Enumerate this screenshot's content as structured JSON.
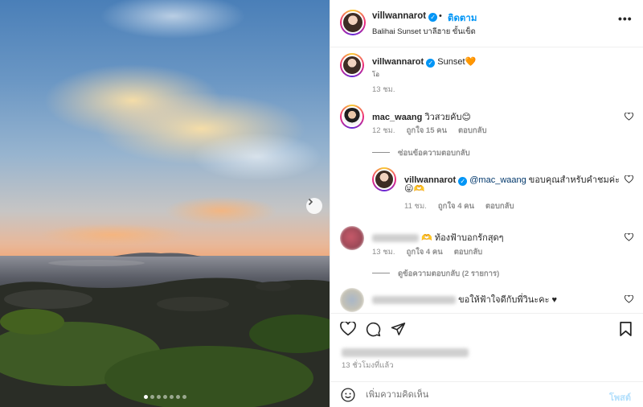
{
  "header": {
    "username": "villwannarot",
    "separator": "•",
    "follow_label": "ติดตาม",
    "location": "Balihai Sunset บาลีฮาย ขั้นเข็ด",
    "more_label": "•••"
  },
  "caption": {
    "username": "villwannarot",
    "text": "Sunset",
    "emoji": "🧡",
    "subtext": "โอ",
    "time": "13 ชม."
  },
  "comments": [
    {
      "username": "mac_waang",
      "text": "วิวสวยคับ😊",
      "time": "12 ชม.",
      "likes": "ถูกใจ 15 คน",
      "reply": "ตอบกลับ",
      "toggle": "ซ่อนข้อความตอบกลับ"
    },
    {
      "username": "villwannarot",
      "mention": "@mac_waang",
      "text": "ขอบคุณสำหรับคำชมค่ะ",
      "text2": "😛🫶",
      "time": "11 ชม.",
      "likes": "ถูกใจ 4 คน",
      "reply": "ตอบกลับ"
    },
    {
      "text": "🫶 ท้องฟ้าบอกรักสุดๆ",
      "time": "13 ชม.",
      "likes": "ถูกใจ 4 คน",
      "reply": "ตอบกลับ",
      "toggle": "ดูข้อความตอบกลับ (2 รายการ)"
    },
    {
      "text": "ขอให้ฟ้าใจดีกับพี่วินะคะ ♥"
    }
  ],
  "footer": {
    "posted": "13 ชั่วโมงที่แล้ว",
    "comment_placeholder": "เพิ่มความคิดเห็น",
    "post_label": "โพสต์"
  },
  "icons": {
    "like": "heart-icon",
    "comment": "comment-icon",
    "share": "share-icon",
    "save": "bookmark-icon",
    "emoji": "emoji-icon",
    "next": "chevron-right-icon"
  },
  "colors": {
    "accent": "#0095f6",
    "text": "#262626",
    "muted": "#8e8e8e"
  },
  "carousel": {
    "slides": 7,
    "active": 1
  }
}
